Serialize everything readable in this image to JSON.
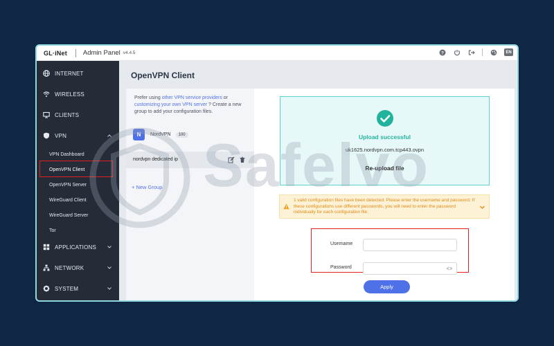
{
  "topbar": {
    "logo": "GL·iNet",
    "title": "Admin Panel",
    "version": "v4.4.5",
    "lang": "EN"
  },
  "sidebar": {
    "items": [
      {
        "label": "INTERNET",
        "icon": "globe-icon"
      },
      {
        "label": "WIRELESS",
        "icon": "wifi-icon"
      },
      {
        "label": "CLIENTS",
        "icon": "monitor-icon"
      },
      {
        "label": "VPN",
        "icon": "shield-icon",
        "expanded": true
      },
      {
        "label": "APPLICATIONS",
        "icon": "grid-icon"
      },
      {
        "label": "NETWORK",
        "icon": "network-icon"
      },
      {
        "label": "SYSTEM",
        "icon": "gear-icon"
      }
    ],
    "vpn_sub": [
      {
        "label": "VPN Dashboard"
      },
      {
        "label": "OpenVPN Client",
        "active": true
      },
      {
        "label": "OpenVPN Server"
      },
      {
        "label": "WireGuard Client"
      },
      {
        "label": "WireGuard Server"
      },
      {
        "label": "Tor"
      }
    ]
  },
  "page": {
    "title": "OpenVPN Client"
  },
  "left_panel": {
    "prefer_1": "Prefer using ",
    "link_providers": "other VPN service providers",
    "prefer_2": " or ",
    "link_customize": "customizing your own VPN server",
    "prefer_3": " ? Create a new group to add your configuration files.",
    "group": {
      "badge": "N",
      "name": "NordVPN",
      "count": "100"
    },
    "config_name": "nordvpn dedicated ip",
    "new_group": "+ New Group"
  },
  "upload": {
    "status": "Upload successful",
    "file_name": "uk1625.nordvpn.com.tcp443.ovpn",
    "reupload": "Re-upload file"
  },
  "warning": {
    "text": "1 valid configuration files have been detected. Please enter the username and password. If these configurations use different passwords, you will need to enter the password individually for each configuration file."
  },
  "form": {
    "username_label": "Username",
    "username_value": "",
    "password_label": "Password",
    "password_value": "",
    "apply": "Apply"
  },
  "watermark": {
    "text": "Safelvo"
  },
  "colors": {
    "accent": "#4f71e8",
    "success": "#21b49c",
    "warning": "#e08a15",
    "highlight": "#e02020",
    "sidebar_bg": "#252b37",
    "page_bg": "#0f2645"
  }
}
